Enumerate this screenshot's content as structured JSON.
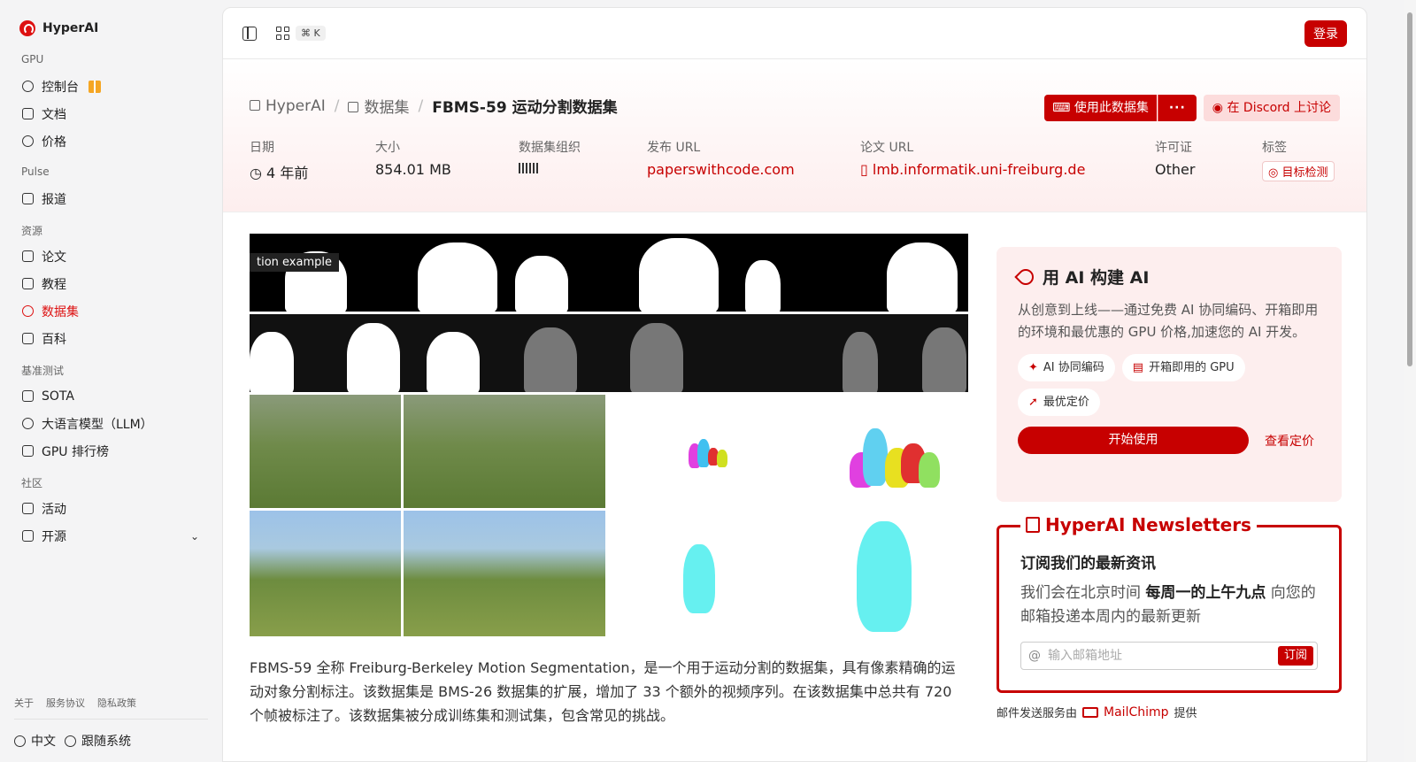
{
  "brand": {
    "name": "HyperAI"
  },
  "sidebar": {
    "sections": [
      {
        "title": "GPU",
        "items": [
          {
            "label": "控制台",
            "icon": "gauge-icon",
            "gift": true
          },
          {
            "label": "文档",
            "icon": "doc-icon"
          },
          {
            "label": "价格",
            "icon": "dollar-icon"
          }
        ]
      },
      {
        "title": "Pulse",
        "items": [
          {
            "label": "报道",
            "icon": "news-icon"
          }
        ]
      },
      {
        "title": "资源",
        "items": [
          {
            "label": "论文",
            "icon": "paper-icon"
          },
          {
            "label": "教程",
            "icon": "book-icon"
          },
          {
            "label": "数据集",
            "icon": "database-icon",
            "active": true
          },
          {
            "label": "百科",
            "icon": "wiki-icon"
          }
        ]
      },
      {
        "title": "基准测试",
        "items": [
          {
            "label": "SOTA",
            "icon": "chart-icon"
          },
          {
            "label": "大语言模型（LLM）",
            "icon": "sparkle-icon"
          },
          {
            "label": "GPU 排行榜",
            "icon": "chip-icon"
          }
        ]
      },
      {
        "title": "社区",
        "items": [
          {
            "label": "活动",
            "icon": "calendar-icon"
          },
          {
            "label": "开源",
            "icon": "list-icon",
            "expandable": true
          }
        ]
      }
    ],
    "footer_links": [
      "关于",
      "服务协议",
      "隐私政策"
    ],
    "language": "中文",
    "theme": "跟随系统"
  },
  "topbar": {
    "shortcut": "⌘ K",
    "login": "登录"
  },
  "breadcrumb": {
    "home": "HyperAI",
    "section": "数据集",
    "current": "FBMS-59 运动分割数据集"
  },
  "actions": {
    "use_dataset": "使用此数据集",
    "more": "···",
    "discord": "在 Discord 上讨论"
  },
  "meta": {
    "date": {
      "label": "日期",
      "value": "4 年前"
    },
    "size": {
      "label": "大小",
      "value": "854.01 MB"
    },
    "org": {
      "label": "数据集组织"
    },
    "publish": {
      "label": "发布 URL",
      "value": "paperswithcode.com"
    },
    "paper": {
      "label": "论文 URL",
      "value": "lmb.informatik.uni-freiburg.de"
    },
    "license": {
      "label": "许可证",
      "value": "Other"
    },
    "tags": {
      "label": "标签",
      "value": "目标检测"
    }
  },
  "figure": {
    "caption": "tion example"
  },
  "description": "FBMS-59 全称 Freiburg-Berkeley Motion Segmentation，是一个用于运动分割的数据集，具有像素精确的运动对象分割标注。该数据集是 BMS-26 数据集的扩展，增加了 33 个额外的视频序列。在该数据集中总共有 720 个帧被标注了。该数据集被分成训练集和测试集，包含常见的挑战。",
  "ai_card": {
    "title": "用 AI 构建 AI",
    "desc": "从创意到上线——通过免费 AI 协同编码、开箱即用的环境和最优惠的 GPU 价格,加速您的 AI 开发。",
    "chips": [
      "AI 协同编码",
      "开箱即用的 GPU",
      "最优定价"
    ],
    "start": "开始使用",
    "pricing": "查看定价"
  },
  "newsletter": {
    "title": "HyperAI Newsletters",
    "heading": "订阅我们的最新资讯",
    "text_before": "我们会在北京时间 ",
    "text_bold": "每周一的上午九点",
    "text_after": " 向您的邮箱投递本周内的最新更新",
    "placeholder": "输入邮箱地址",
    "subscribe": "订阅",
    "credit_before": "邮件发送服务由",
    "credit_brand": "MailChimp",
    "credit_after": "提供"
  },
  "colors": {
    "accent": "#c70000",
    "hero_tint": "#fdeeee"
  }
}
